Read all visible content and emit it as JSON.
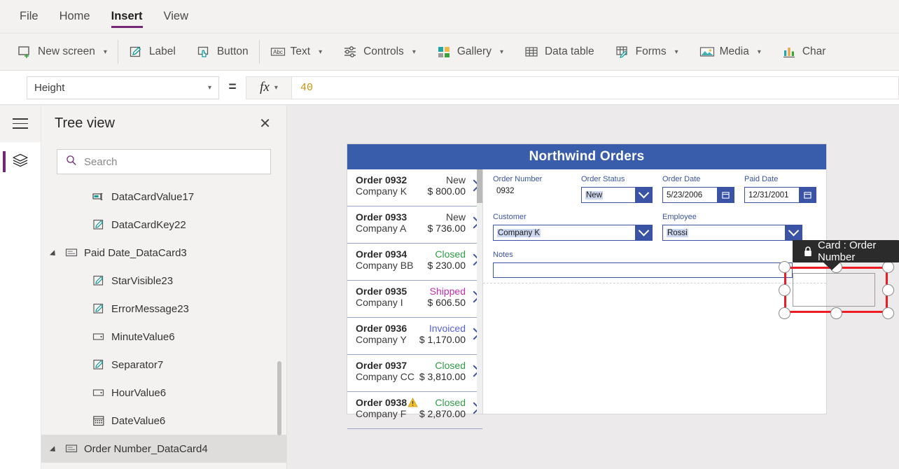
{
  "menubar": {
    "items": [
      {
        "label": "File",
        "active": false
      },
      {
        "label": "Home",
        "active": false
      },
      {
        "label": "Insert",
        "active": true
      },
      {
        "label": "View",
        "active": false
      }
    ]
  },
  "ribbon": {
    "items": [
      {
        "label": "New screen",
        "icon": "new-screen-icon",
        "caret": true
      },
      {
        "label": "Label",
        "icon": "label-icon",
        "caret": false
      },
      {
        "label": "Button",
        "icon": "button-icon",
        "caret": false
      },
      {
        "label": "Text",
        "icon": "text-icon",
        "caret": true
      },
      {
        "label": "Controls",
        "icon": "controls-icon",
        "caret": true
      },
      {
        "label": "Gallery",
        "icon": "gallery-icon",
        "caret": true
      },
      {
        "label": "Data table",
        "icon": "data-table-icon",
        "caret": false
      },
      {
        "label": "Forms",
        "icon": "forms-icon",
        "caret": true
      },
      {
        "label": "Media",
        "icon": "media-icon",
        "caret": true
      },
      {
        "label": "Char",
        "icon": "charts-icon",
        "caret": false
      }
    ]
  },
  "formula_bar": {
    "property": "Height",
    "equals": "=",
    "fx": "fx",
    "value": "40"
  },
  "tree_view": {
    "title": "Tree view",
    "close_label": "✕",
    "search_placeholder": "Search",
    "items": [
      {
        "label": "DataCardValue17",
        "icon": "text-input-icon",
        "indent": 4,
        "twisty": false,
        "selected": false
      },
      {
        "label": "DataCardKey22",
        "icon": "label-icon",
        "indent": 4,
        "twisty": false,
        "selected": false
      },
      {
        "label": "Paid Date_DataCard3",
        "icon": "datacard-icon",
        "indent": 3,
        "twisty": true,
        "selected": false
      },
      {
        "label": "StarVisible23",
        "icon": "label-icon",
        "indent": 4,
        "twisty": false,
        "selected": false
      },
      {
        "label": "ErrorMessage23",
        "icon": "label-icon",
        "indent": 4,
        "twisty": false,
        "selected": false
      },
      {
        "label": "MinuteValue6",
        "icon": "dropdown-icon",
        "indent": 4,
        "twisty": false,
        "selected": false
      },
      {
        "label": "Separator7",
        "icon": "label-icon",
        "indent": 4,
        "twisty": false,
        "selected": false
      },
      {
        "label": "HourValue6",
        "icon": "dropdown-icon",
        "indent": 4,
        "twisty": false,
        "selected": false
      },
      {
        "label": "DateValue6",
        "icon": "date-picker-icon",
        "indent": 4,
        "twisty": false,
        "selected": false
      },
      {
        "label": "Order Number_DataCard4",
        "icon": "datacard-icon",
        "indent": 3,
        "twisty": true,
        "selected": true
      }
    ]
  },
  "canvas": {
    "app_title": "Northwind Orders",
    "tooltip": {
      "label": "Card : Order Number",
      "icon": "lock-icon"
    },
    "gallery": [
      {
        "order": "Order 0938",
        "company": "Company F",
        "status": "Closed",
        "status_color": "#2e9c45",
        "amount": "$ 2,870.00",
        "warning": true
      },
      {
        "order": "Order 0937",
        "company": "Company CC",
        "status": "Closed",
        "status_color": "#2e9c45",
        "amount": "$ 3,810.00",
        "warning": false
      },
      {
        "order": "Order 0936",
        "company": "Company Y",
        "status": "Invoiced",
        "status_color": "#5560e0",
        "amount": "$ 1,170.00",
        "warning": false
      },
      {
        "order": "Order 0935",
        "company": "Company I",
        "status": "Shipped",
        "status_color": "#c02fb0",
        "amount": "$ 606.50",
        "warning": false
      },
      {
        "order": "Order 0934",
        "company": "Company BB",
        "status": "Closed",
        "status_color": "#2e9c45",
        "amount": "$ 230.00",
        "warning": false
      },
      {
        "order": "Order 0933",
        "company": "Company A",
        "status": "New",
        "status_color": "#3b3b3b",
        "amount": "$ 736.00",
        "warning": false
      },
      {
        "order": "Order 0932",
        "company": "Company K",
        "status": "New",
        "status_color": "#3b3b3b",
        "amount": "$ 800.00",
        "warning": false
      }
    ],
    "form": {
      "order_number": {
        "label": "Order Number",
        "value": "0932"
      },
      "order_status": {
        "label": "Order Status",
        "value": "New"
      },
      "order_date": {
        "label": "Order Date",
        "value": "5/23/2006"
      },
      "paid_date": {
        "label": "Paid Date",
        "value": "12/31/2001"
      },
      "customer": {
        "label": "Customer",
        "value": "Company K"
      },
      "employee": {
        "label": "Employee",
        "value": "Rossi"
      },
      "notes": {
        "label": "Notes",
        "value": ""
      }
    }
  },
  "colors": {
    "accent_purple": "#742774",
    "app_blue": "#3a5dab",
    "selection_red": "#ee1b24",
    "formula_value": "#c8900f"
  }
}
